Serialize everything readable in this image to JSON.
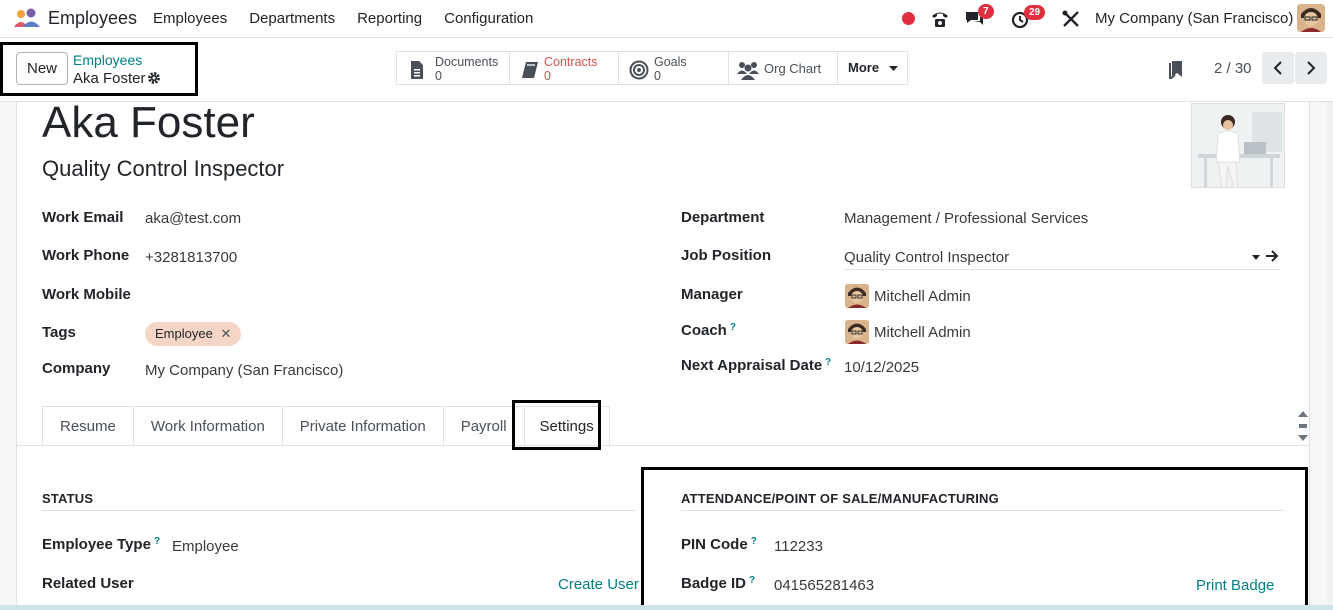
{
  "navbar": {
    "app_name": "Employees",
    "menu": [
      "Employees",
      "Departments",
      "Reporting",
      "Configuration"
    ],
    "chat_badge": "7",
    "activity_badge": "29",
    "company": "My Company (San Francisco)"
  },
  "control": {
    "new_label": "New",
    "breadcrumb_parent": "Employees",
    "breadcrumb_current": "Aka Foster",
    "smart_buttons": {
      "documents": {
        "label": "Documents",
        "count": "0"
      },
      "contracts": {
        "label": "Contracts",
        "count": "0"
      },
      "goals": {
        "label": "Goals",
        "count": "0"
      },
      "org_chart": {
        "label": "Org Chart"
      },
      "more": {
        "label": "More"
      }
    },
    "pager": "2 / 30"
  },
  "employee": {
    "name": "Aka Foster",
    "job_title": "Quality Control Inspector",
    "left_fields": {
      "work_email": {
        "label": "Work Email",
        "value": "aka@test.com"
      },
      "work_phone": {
        "label": "Work Phone",
        "value": "+3281813700"
      },
      "work_mobile": {
        "label": "Work Mobile",
        "value": ""
      },
      "tags": {
        "label": "Tags",
        "value": "Employee"
      },
      "company": {
        "label": "Company",
        "value": "My Company (San Francisco)"
      }
    },
    "right_fields": {
      "department": {
        "label": "Department",
        "value": "Management / Professional Services"
      },
      "job_position": {
        "label": "Job Position",
        "value": "Quality Control Inspector"
      },
      "manager": {
        "label": "Manager",
        "value": "Mitchell Admin"
      },
      "coach": {
        "label": "Coach",
        "value": "Mitchell Admin"
      },
      "next_appraisal": {
        "label": "Next Appraisal Date",
        "value": "10/12/2025"
      }
    }
  },
  "tabs": [
    "Resume",
    "Work Information",
    "Private Information",
    "Payroll",
    "Settings"
  ],
  "settings": {
    "status_title": "STATUS",
    "employee_type": {
      "label": "Employee Type",
      "value": "Employee"
    },
    "related_user": {
      "label": "Related User",
      "action": "Create User"
    },
    "attendance_title": "ATTENDANCE/POINT OF SALE/MANUFACTURING",
    "pin_code": {
      "label": "PIN Code",
      "value": "112233"
    },
    "badge_id": {
      "label": "Badge ID",
      "value": "041565281463",
      "action": "Print Badge"
    }
  },
  "help_mark": "?",
  "colors": {
    "accent": "#017e84",
    "badge_red": "#e0303f",
    "tag_bg": "#f5d5c5"
  }
}
